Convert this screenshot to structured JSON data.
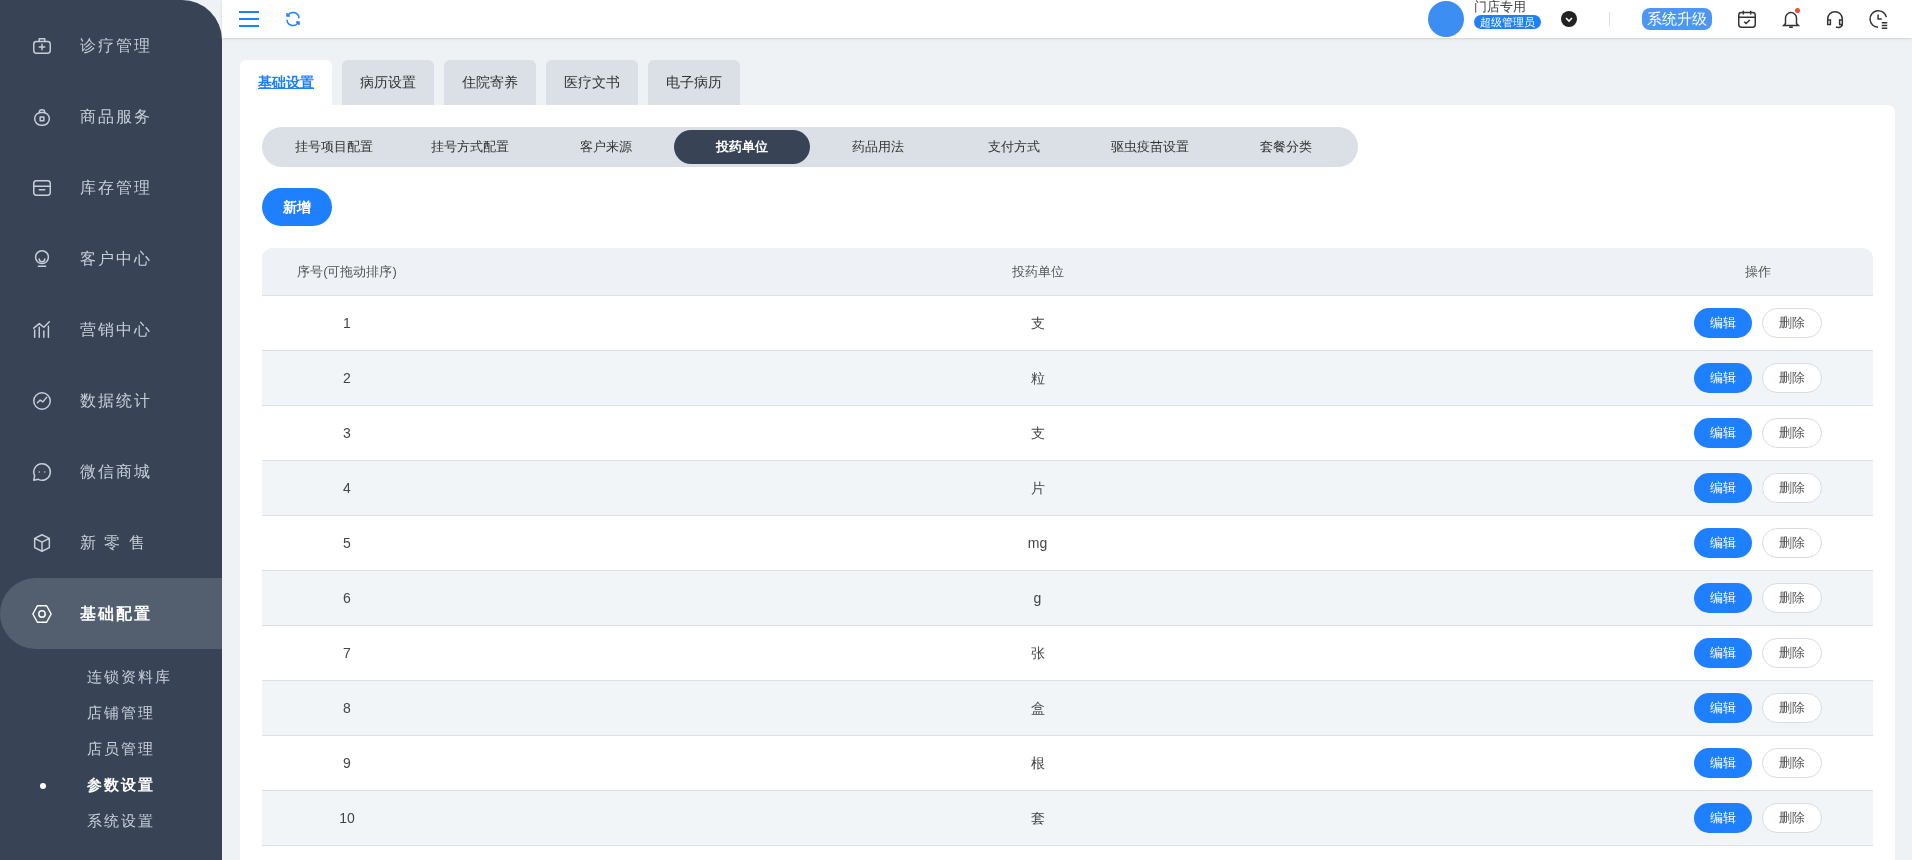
{
  "sidebar": {
    "items": [
      {
        "label": "诊疗管理",
        "selected": false
      },
      {
        "label": "商品服务",
        "selected": false
      },
      {
        "label": "库存管理",
        "selected": false
      },
      {
        "label": "客户中心",
        "selected": false
      },
      {
        "label": "营销中心",
        "selected": false
      },
      {
        "label": "数据统计",
        "selected": false
      },
      {
        "label": "微信商城",
        "selected": false
      },
      {
        "label": "新 零 售",
        "selected": false
      },
      {
        "label": "基础配置",
        "selected": true,
        "children": [
          {
            "label": "连锁资料库",
            "selected": false
          },
          {
            "label": "店铺管理",
            "selected": false
          },
          {
            "label": "店员管理",
            "selected": false
          },
          {
            "label": "参数设置",
            "selected": true
          },
          {
            "label": "系统设置",
            "selected": false
          }
        ]
      }
    ]
  },
  "topbar": {
    "user_name": "门店专用",
    "role_badge": "超级管理员",
    "upgrade_button": "系统升级",
    "has_notification": true
  },
  "tabs": [
    {
      "label": "基础设置",
      "selected": true
    },
    {
      "label": "病历设置",
      "selected": false
    },
    {
      "label": "住院寄养",
      "selected": false
    },
    {
      "label": "医疗文书",
      "selected": false
    },
    {
      "label": "电子病历",
      "selected": false
    }
  ],
  "subtabs": [
    {
      "label": "挂号项目配置",
      "selected": false
    },
    {
      "label": "挂号方式配置",
      "selected": false
    },
    {
      "label": "客户来源",
      "selected": false
    },
    {
      "label": "投药单位",
      "selected": true
    },
    {
      "label": "药品用法",
      "selected": false
    },
    {
      "label": "支付方式",
      "selected": false
    },
    {
      "label": "驱虫疫苗设置",
      "selected": false
    },
    {
      "label": "套餐分类",
      "selected": false
    }
  ],
  "add_button": "新增",
  "table": {
    "columns": [
      "序号(可拖动排序)",
      "投药单位",
      "操作"
    ],
    "rows": [
      {
        "index": "1",
        "unit": "支",
        "edit": "编辑",
        "delete": "删除"
      },
      {
        "index": "2",
        "unit": "粒",
        "edit": "编辑",
        "delete": "删除"
      },
      {
        "index": "3",
        "unit": "支",
        "edit": "编辑",
        "delete": "删除"
      },
      {
        "index": "4",
        "unit": "片",
        "edit": "编辑",
        "delete": "删除"
      },
      {
        "index": "5",
        "unit": "mg",
        "edit": "编辑",
        "delete": "删除"
      },
      {
        "index": "6",
        "unit": "g",
        "edit": "编辑",
        "delete": "删除"
      },
      {
        "index": "7",
        "unit": "张",
        "edit": "编辑",
        "delete": "删除"
      },
      {
        "index": "8",
        "unit": "盒",
        "edit": "编辑",
        "delete": "删除"
      },
      {
        "index": "9",
        "unit": "根",
        "edit": "编辑",
        "delete": "删除"
      },
      {
        "index": "10",
        "unit": "套",
        "edit": "编辑",
        "delete": "删除"
      }
    ]
  }
}
